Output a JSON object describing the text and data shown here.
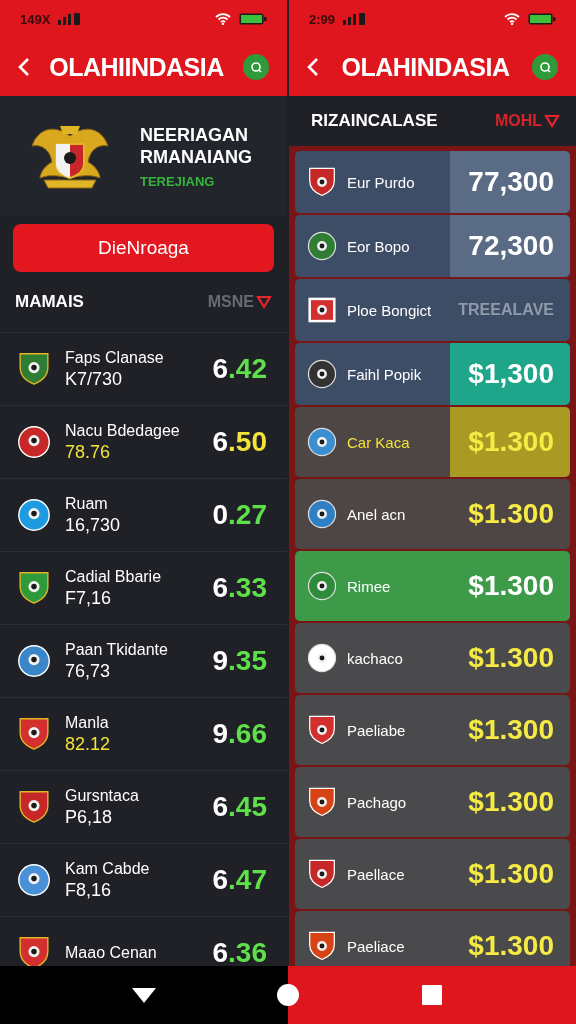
{
  "left": {
    "status_time": "149X",
    "title": "OLAHIINDASIA",
    "hero": {
      "title_lines": [
        "NEERIAGAN",
        "RMANAIANG"
      ],
      "subtitle": "TEREJIANG"
    },
    "action_button": "DieNroaga",
    "section": {
      "title": "MAMAIS",
      "sort_label": "MSNE"
    },
    "rows": [
      {
        "name": "Faps Clanase",
        "detail": "K7/730",
        "detail_highlighted": false,
        "whole": "6",
        "fraction": ".42",
        "caution": false,
        "crest": {
          "kind": "shield",
          "color": "#2e7d32"
        }
      },
      {
        "name": "Nacu Bdedagee",
        "detail": "78.76",
        "detail_highlighted": true,
        "whole": "6",
        "fraction": ".50",
        "caution": true,
        "crest": {
          "kind": "circle",
          "color": "#c62828"
        }
      },
      {
        "name": "Ruam",
        "detail": "16,730",
        "detail_highlighted": false,
        "whole": "0",
        "fraction": ".27",
        "caution": false,
        "crest": {
          "kind": "circle",
          "color": "#1e9be0"
        }
      },
      {
        "name": "Cadial Bbarie",
        "detail": "F7,16",
        "detail_highlighted": false,
        "whole": "6",
        "fraction": ".33",
        "caution": false,
        "crest": {
          "kind": "shield",
          "color": "#2e9a3a"
        }
      },
      {
        "name": "Paan Tkidante",
        "detail": "76,73",
        "detail_highlighted": false,
        "whole": "9",
        "fraction": ".35",
        "caution": false,
        "crest": {
          "kind": "circle",
          "color": "#3a86c8"
        }
      },
      {
        "name": "Manla",
        "detail": "82.12",
        "detail_highlighted": true,
        "whole": "9",
        "fraction": ".66",
        "caution": false,
        "crest": {
          "kind": "shield",
          "color": "#d32f2f"
        }
      },
      {
        "name": "Gursntaca",
        "detail": "P6,18",
        "detail_highlighted": false,
        "whole": "6",
        "fraction": ".45",
        "caution": false,
        "crest": {
          "kind": "shield",
          "color": "#c62828"
        }
      },
      {
        "name": "Kam Cabde",
        "detail": "F8,16",
        "detail_highlighted": false,
        "whole": "6",
        "fraction": ".47",
        "caution": false,
        "crest": {
          "kind": "circle",
          "color": "#4a90d9"
        }
      },
      {
        "name": "Maao Cenan",
        "whole": "6",
        "fraction": ".36",
        "caution": false,
        "crest": {
          "kind": "shield",
          "color": "#d32f2f"
        }
      }
    ]
  },
  "right": {
    "status_time": "2:99",
    "title": "OLAHINDASIA",
    "section": {
      "title": "RIZAINCALASE",
      "sort_label": "MOHL"
    },
    "cards": [
      {
        "kind": "slate",
        "name": "Eur Purdo",
        "name_highlighted": false,
        "price": {
          "kind": "amount",
          "text": "77,300",
          "highlighted": false,
          "box": {
            "color": "#5a6b86"
          }
        },
        "crest": {
          "kind": "shield",
          "color": "#c62828"
        }
      },
      {
        "kind": "slate",
        "name": "Eor Bopo",
        "name_highlighted": false,
        "price": {
          "kind": "amount",
          "text": "72,300",
          "highlighted": false,
          "box": {
            "color": "#5a6b86"
          }
        },
        "crest": {
          "kind": "circle",
          "color": "#2e7d32"
        }
      },
      {
        "kind": "slate",
        "name": "Ploe Bongict",
        "name_highlighted": false,
        "price": {
          "kind": "label",
          "text": "TREEALAVE"
        },
        "crest": {
          "kind": "flag",
          "color": "#d32f2f"
        }
      },
      {
        "kind": "slate",
        "name": "Faihl Popik",
        "name_highlighted": false,
        "price": {
          "kind": "amount",
          "text": "$1,300",
          "highlighted": false,
          "box": {
            "color": "#1fa58a"
          }
        },
        "crest": {
          "kind": "circle",
          "color": "#333333"
        }
      },
      {
        "kind": "brown",
        "name": "Car Kaca",
        "name_highlighted": true,
        "price": {
          "kind": "amount",
          "text": "$1.300",
          "highlighted": true,
          "box": {
            "color": "#a89a22"
          }
        },
        "crest": {
          "kind": "circle",
          "color": "#3a8fd0"
        }
      },
      {
        "kind": "brown",
        "name": "Anel acn",
        "name_highlighted": false,
        "price": {
          "kind": "amount",
          "text": "$1.300",
          "highlighted": true
        },
        "crest": {
          "kind": "circle",
          "color": "#2f7fc4"
        }
      },
      {
        "kind": "green",
        "name": "Rimee",
        "name_highlighted": false,
        "price": {
          "kind": "amount",
          "text": "$1.300",
          "highlighted": false
        },
        "crest": {
          "kind": "circle",
          "color": "#2e8b3a"
        }
      },
      {
        "kind": "grey",
        "name": "kachaco",
        "name_highlighted": false,
        "price": {
          "kind": "amount",
          "text": "$1.300",
          "highlighted": true
        },
        "crest": {
          "kind": "circle",
          "color": "#ffffff"
        }
      },
      {
        "kind": "grey",
        "name": "Paeliabe",
        "name_highlighted": false,
        "price": {
          "kind": "amount",
          "text": "$1.300",
          "highlighted": true
        },
        "crest": {
          "kind": "shield",
          "color": "#d32f2f"
        }
      },
      {
        "kind": "grey",
        "name": "Pachago",
        "name_highlighted": false,
        "price": {
          "kind": "amount",
          "text": "$1.300",
          "highlighted": true
        },
        "crest": {
          "kind": "shield",
          "color": "#d84315"
        }
      },
      {
        "kind": "grey",
        "name": "Paellace",
        "name_highlighted": false,
        "price": {
          "kind": "amount",
          "text": "$1.300",
          "highlighted": true
        },
        "crest": {
          "kind": "shield",
          "color": "#c62828"
        }
      },
      {
        "kind": "grey",
        "name": "Paeliace",
        "name_highlighted": false,
        "price": {
          "kind": "amount",
          "text": "$1.300",
          "highlighted": true
        },
        "crest": {
          "kind": "shield",
          "color": "#d84315"
        }
      }
    ]
  }
}
